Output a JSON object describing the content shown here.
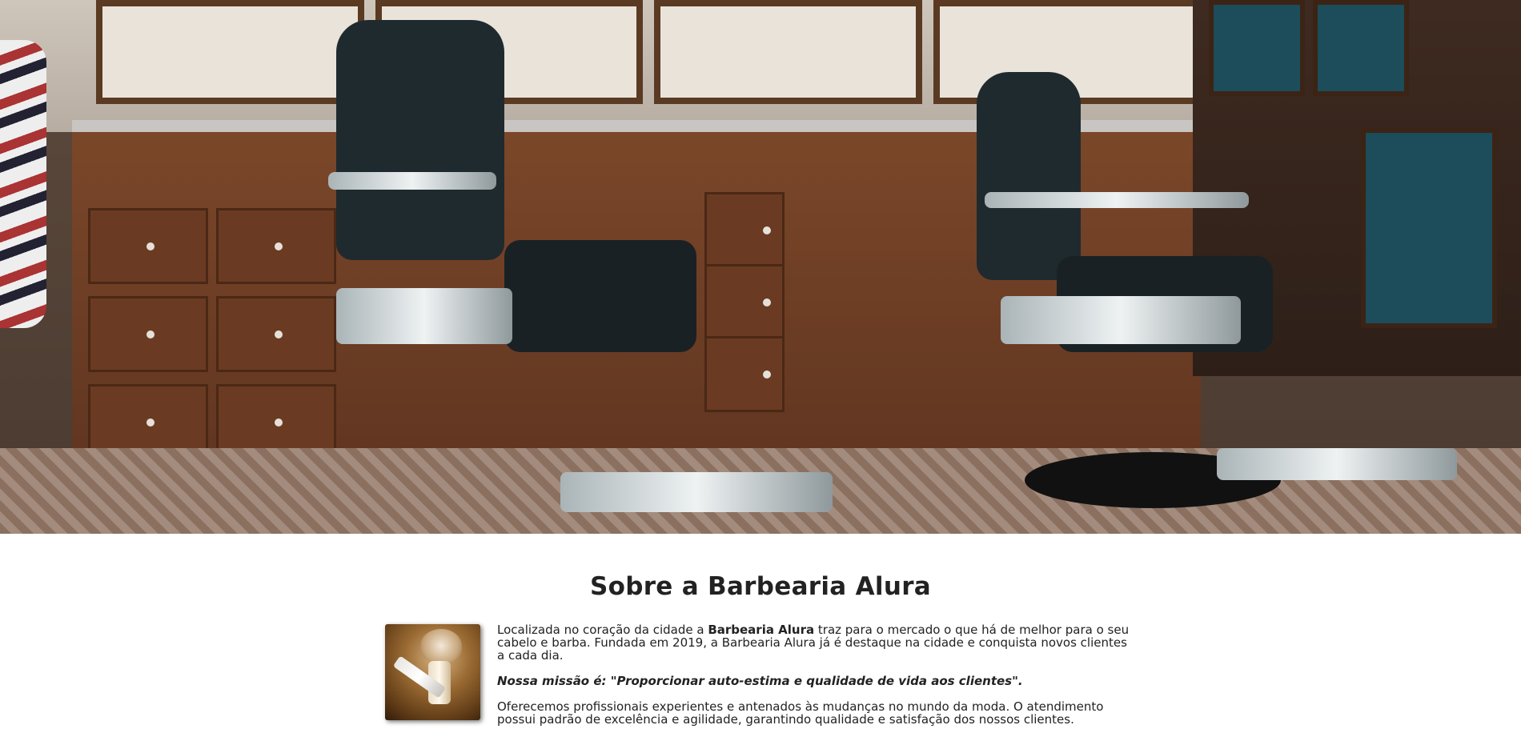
{
  "hero": {
    "image_subject": "barber-shop-interior"
  },
  "about": {
    "title_first_letter": "S",
    "title_rest": "obre a Barbearia Alura",
    "intro_before": "Localizada no coração da cidade a ",
    "intro_brand": "Barbearia Alura",
    "intro_after": " traz para o mercado o que há de melhor para o seu cabelo e barba. Fundada em 2019, a Barbearia Alura já é destaque na cidade e conquista novos clientes a cada dia.",
    "mission": "Nossa missão é: \"Proporcionar auto-estima e qualidade de vida aos clientes\".",
    "services": "Oferecemos profissionais experientes e antenados às mudanças no mundo da moda. O atendimento possui padrão de excelência e agilidade, garantindo qualidade e satisfação dos nossos clientes."
  },
  "colors": {
    "text": "#222222",
    "background": "#ffffff"
  }
}
